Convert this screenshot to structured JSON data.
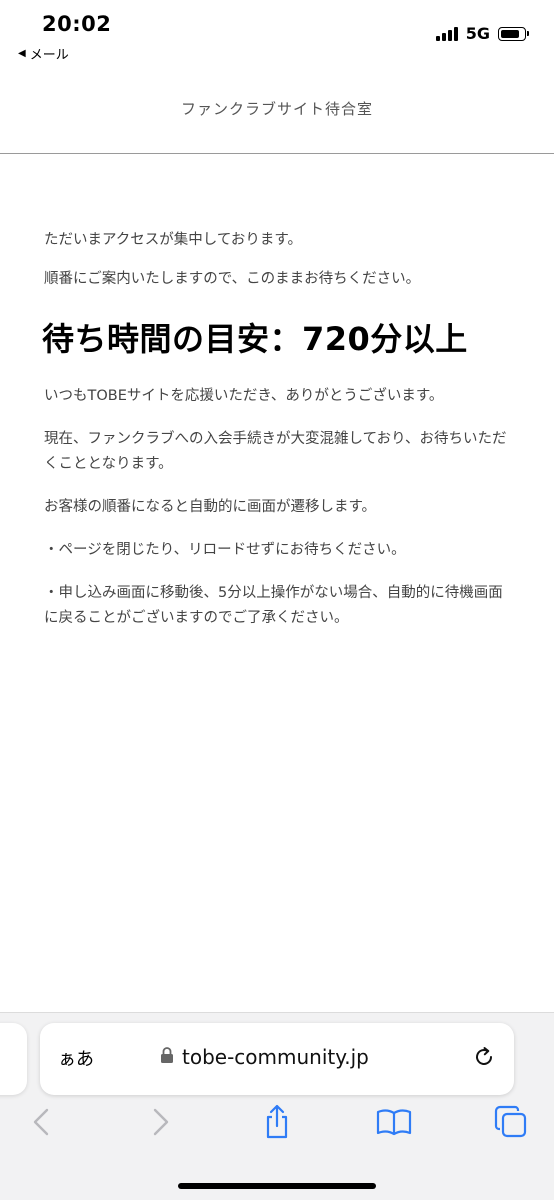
{
  "status_bar": {
    "time": "20:02",
    "back_label": "メール",
    "network": "5G",
    "icons": [
      "back-arrow-icon",
      "signal-icon",
      "battery-icon"
    ]
  },
  "header": {
    "title": "ファンクラブサイト待合室"
  },
  "main": {
    "intro_line1": "ただいまアクセスが集中しております。",
    "intro_line2": "順番にご案内いたしますので、このままお待ちください。",
    "wait_heading": "待ち時間の目安：720分以上",
    "body": [
      "いつもTOBEサイトを応援いただき、ありがとうございます。",
      "現在、ファンクラブへの入会手続きが大変混雑しており、お待ちいただくこととなります。",
      "お客様の順番になると自動的に画面が遷移します。",
      "・ページを閉じたり、リロードせずにお待ちください。",
      "・申し込み画面に移動後、5分以上操作がない場合、自動的に待機画面に戻ることがございますのでご了承ください。"
    ]
  },
  "browser": {
    "aa_label": "ぁあ",
    "url": "tobe-community.jp",
    "accent_color": "#2f7cf6",
    "disabled_color": "#b8b8bc",
    "toolbar_icons": [
      "back-icon",
      "forward-icon",
      "share-icon",
      "bookmarks-icon",
      "tabs-icon"
    ]
  }
}
